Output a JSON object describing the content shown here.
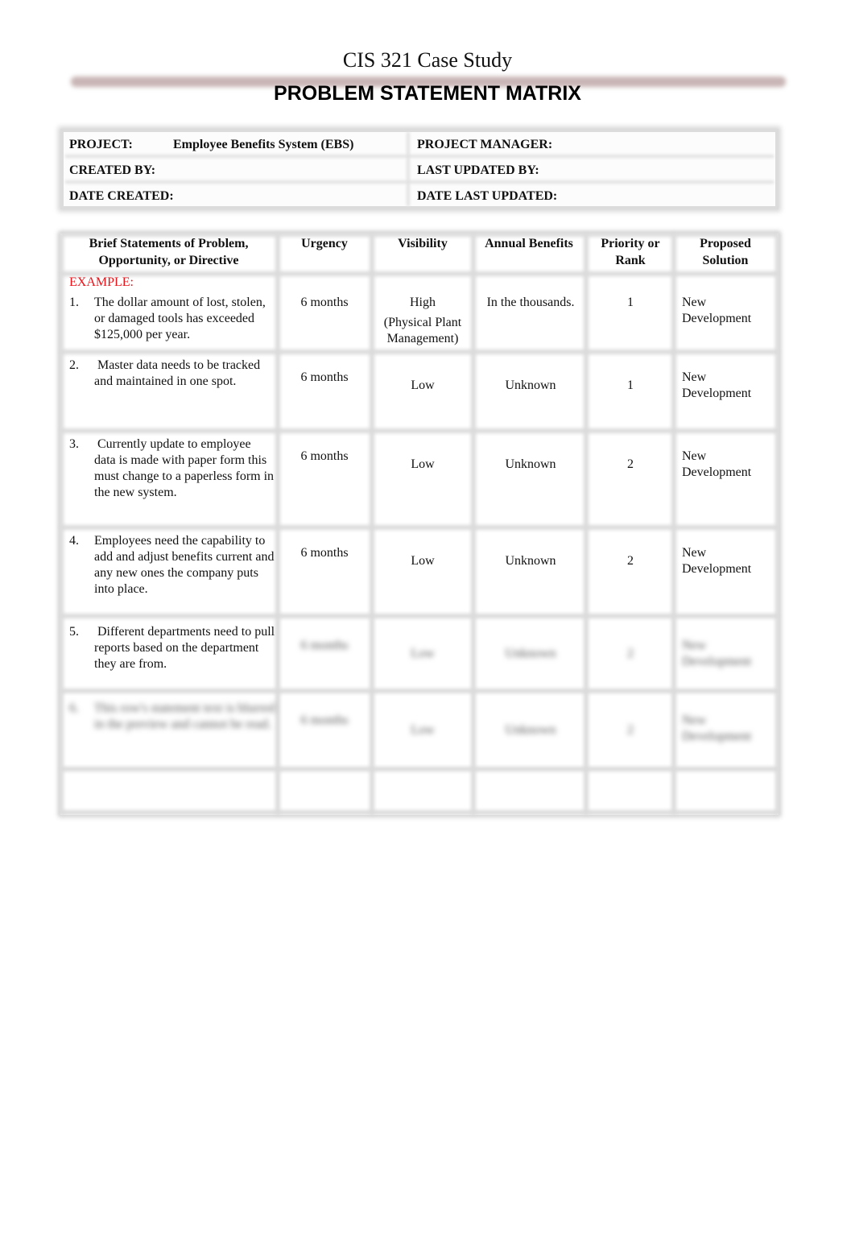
{
  "document": {
    "course_title": "CIS 321 Case Study",
    "main_title": "PROBLEM STATEMENT MATRIX"
  },
  "info": {
    "project_label": "PROJECT:",
    "project_value": "Employee Benefits System (EBS)",
    "project_manager_label": "PROJECT MANAGER:",
    "created_by_label": "CREATED BY:",
    "last_updated_by_label": "LAST UPDATED BY:",
    "date_created_label": "DATE CREATED:",
    "date_last_updated_label": "DATE LAST UPDATED:"
  },
  "matrix": {
    "headers": {
      "statement": "Brief Statements of Problem, Opportunity, or Directive",
      "urgency": "Urgency",
      "visibility": "Visibility",
      "benefits": "Annual Benefits",
      "priority": "Priority or Rank",
      "solution": "Proposed Solution"
    },
    "example_label": "EXAMPLE:",
    "rows": [
      {
        "number": "1.",
        "statement": "The dollar amount of lost, stolen, or damaged tools has exceeded $125,000 per year.",
        "urgency": "6 months",
        "visibility": "High",
        "visibility_note": "(Physical Plant Management)",
        "benefits": "In the thousands.",
        "priority": "1",
        "solution": "New Development"
      },
      {
        "number": "2.",
        "statement": " Master data needs to be tracked and maintained in one spot.",
        "urgency": "6 months",
        "visibility": "Low",
        "benefits": "Unknown",
        "priority": "1",
        "solution": "New Development"
      },
      {
        "number": "3.",
        "statement": " Currently update to employee data is made with paper form this must change to a paperless form in the new system.",
        "urgency": "6 months",
        "visibility": "Low",
        "benefits": "Unknown",
        "priority": "2",
        "solution": "New Development"
      },
      {
        "number": "4.",
        "statement": "Employees need the capability to add and adjust benefits current and any new ones the company puts into place.",
        "urgency": "6 months",
        "visibility": "Low",
        "benefits": "Unknown",
        "priority": "2",
        "solution": "New Development"
      },
      {
        "number": "5.",
        "statement": " Different departments need to pull reports based on the department they are from.",
        "urgency": "6 months",
        "visibility": "Low",
        "benefits": "Unknown",
        "priority": "2",
        "solution": "New Development"
      },
      {
        "number": "6.",
        "statement": "This row's statement text is blurred in the preview and cannot be read.",
        "urgency": "6 months",
        "visibility": "Low",
        "benefits": "Unknown",
        "priority": "2",
        "solution": "New Development"
      }
    ]
  }
}
